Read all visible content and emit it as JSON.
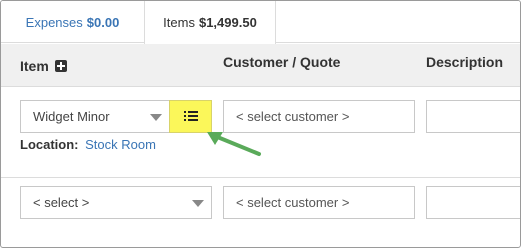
{
  "tabs": {
    "expenses": {
      "label": "Expenses",
      "amount": "$0.00"
    },
    "items": {
      "label": "Items",
      "amount": "$1,499.50"
    }
  },
  "header": {
    "item": "Item",
    "customer": "Customer / Quote",
    "description": "Description"
  },
  "rows": [
    {
      "item_value": "Widget Minor",
      "customer_placeholder": "< select customer >",
      "location_label": "Location:",
      "location_value": "Stock Room"
    },
    {
      "item_value": "< select >",
      "customer_placeholder": "< select customer >"
    }
  ],
  "colors": {
    "accent": "#3a75b5",
    "highlight": "#fbf75a",
    "arrow": "#5aaa5a"
  }
}
